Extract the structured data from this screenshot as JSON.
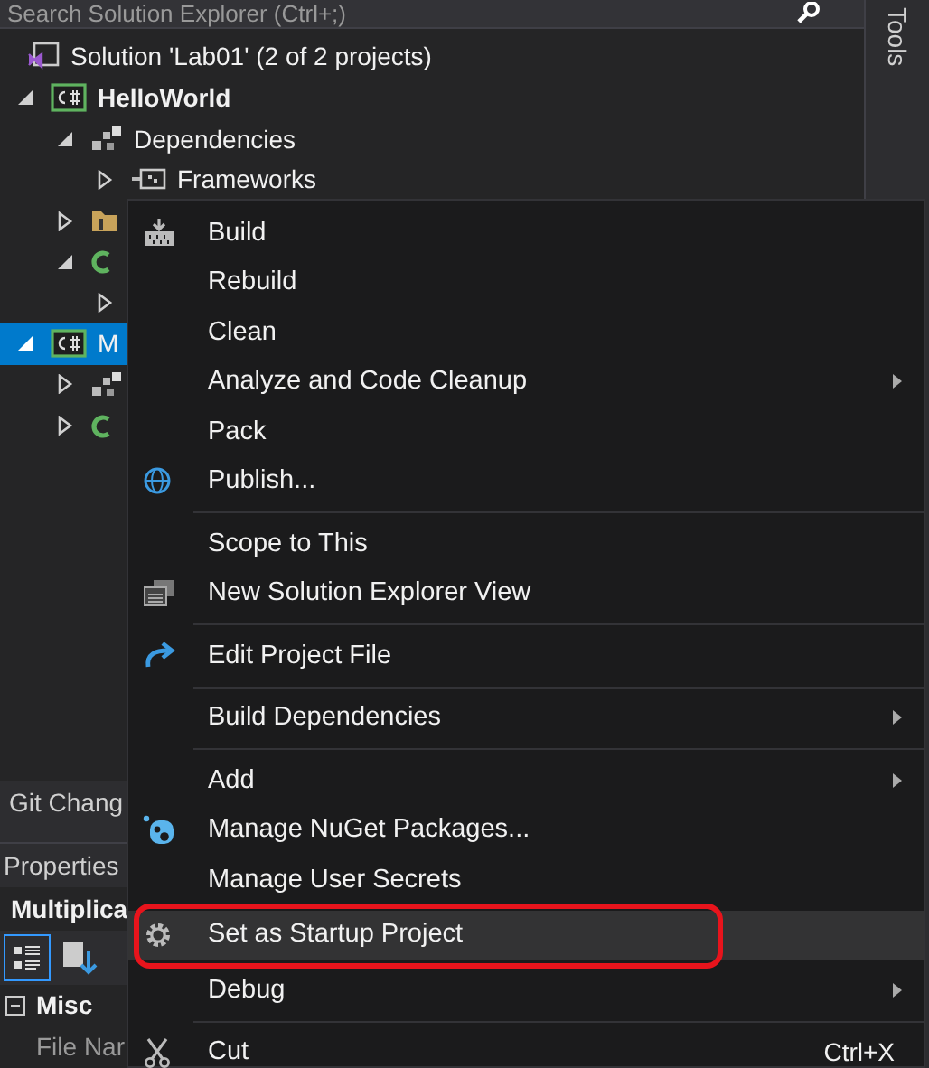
{
  "search": {
    "placeholder": "Search Solution Explorer (Ctrl+;)"
  },
  "side_tab": "Tools",
  "tree": [
    {
      "kind": "solution",
      "label": "Solution 'Lab01' (2 of 2 projects)",
      "selected": false,
      "children": [
        {
          "kind": "project",
          "label": "HelloWorld",
          "startup": true,
          "expanded": true,
          "selected": false,
          "children": [
            {
              "kind": "dependencies",
              "label": "Dependencies",
              "expanded": true,
              "selected": false,
              "children": [
                {
                  "kind": "frameworks",
                  "label": "Frameworks",
                  "expanded": false,
                  "selected": false
                }
              ]
            },
            {
              "kind": "properties",
              "expanded": false,
              "selected": false
            },
            {
              "kind": "code",
              "expanded": true,
              "selected": false,
              "children": [
                {
                  "kind": "file",
                  "expanded": false,
                  "selected": false
                }
              ]
            }
          ]
        },
        {
          "kind": "project",
          "label": "M",
          "startup": false,
          "expanded": true,
          "selected": true,
          "children": [
            {
              "kind": "dependencies",
              "expanded": false,
              "selected": false
            },
            {
              "kind": "code",
              "expanded": false,
              "selected": false
            }
          ]
        }
      ]
    }
  ],
  "git_tab": "Git Chang",
  "properties": {
    "title": "Properties",
    "object": "Multiplica",
    "categorized": true,
    "category": "Misc",
    "category_expanded": true,
    "row": "File Nar"
  },
  "menu": [
    {
      "kind": "item",
      "label": "Build",
      "submenu": false,
      "selected": false
    },
    {
      "kind": "item",
      "label": "Rebuild",
      "submenu": false,
      "selected": false
    },
    {
      "kind": "item",
      "label": "Clean",
      "submenu": false,
      "selected": false
    },
    {
      "kind": "item",
      "label": "Analyze and Code Cleanup",
      "submenu": true,
      "selected": false
    },
    {
      "kind": "item",
      "label": "Pack",
      "submenu": false,
      "selected": false
    },
    {
      "kind": "item",
      "label": "Publish...",
      "submenu": false,
      "selected": false
    },
    {
      "kind": "separator"
    },
    {
      "kind": "item",
      "label": "Scope to This",
      "submenu": false,
      "selected": false
    },
    {
      "kind": "item",
      "label": "New Solution Explorer View",
      "submenu": false,
      "selected": false
    },
    {
      "kind": "separator"
    },
    {
      "kind": "item",
      "label": "Edit Project File",
      "submenu": false,
      "selected": false
    },
    {
      "kind": "separator"
    },
    {
      "kind": "item",
      "label": "Build Dependencies",
      "submenu": true,
      "selected": false
    },
    {
      "kind": "separator"
    },
    {
      "kind": "item",
      "label": "Add",
      "submenu": true,
      "selected": false
    },
    {
      "kind": "item",
      "label": "Manage NuGet Packages...",
      "submenu": false,
      "selected": false
    },
    {
      "kind": "item",
      "label": "Manage User Secrets",
      "submenu": false,
      "selected": false
    },
    {
      "kind": "item",
      "label": "Set as Startup Project",
      "submenu": false,
      "selected": true,
      "circled": true
    },
    {
      "kind": "item",
      "label": "Debug",
      "submenu": true,
      "selected": false
    },
    {
      "kind": "separator"
    },
    {
      "kind": "item",
      "label": "Cut",
      "shortcut": "Ctrl+X",
      "submenu": false,
      "selected": false
    }
  ]
}
